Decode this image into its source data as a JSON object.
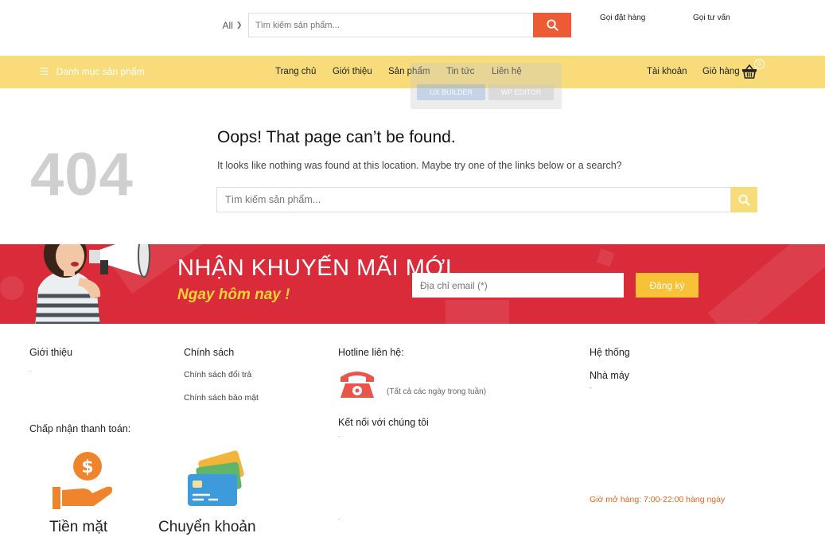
{
  "header": {
    "category_select": "All",
    "search_placeholder": "Tìm kiếm sản phẩm...",
    "call_order": "Gọi đặt hàng",
    "call_consult": "Gọi tư vấn"
  },
  "nav": {
    "menu_label": "Danh mục sản phẩm",
    "items": [
      "Trang chủ",
      "Giới thiệu",
      "Sản phẩm",
      "Tin tức",
      "Liên hệ"
    ],
    "account": "Tài khoản",
    "cart": "Giỏ hàng",
    "cart_count": "0",
    "overlay_buttons": [
      "UX BUILDER",
      "WP EDITOR"
    ]
  },
  "not_found": {
    "code": "404",
    "title": "Oops! That page can’t be found.",
    "message": "It looks like nothing was found at this location. Maybe try one of the links below or a search?",
    "search_placeholder": "Tìm kiếm sản phẩm..."
  },
  "promo": {
    "title": "NHẬN KHUYẾN MÃI MỚI",
    "subtitle": "Ngay hôm nay !",
    "email_placeholder": "Địa chỉ email (*)",
    "subscribe_label": "Đăng ký"
  },
  "footer": {
    "about_title": "Giới thiệu",
    "about_text": ".",
    "policy_title": "Chính sách",
    "policy_links": [
      "Chính sách đổi trả",
      "Chính sách bảo mật"
    ],
    "hotline_title": "Hotline liên hệ:",
    "hotline_note": "(Tất cả các ngày trong tuần)",
    "connect_title": "Kết nối với chúng tôi",
    "connect_text": ".",
    "bottom_dot": ".",
    "system_title": "Hệ thống",
    "factory": "Nhà máy",
    "factory_text": "-",
    "hours": "Giờ mở hàng: 7:00-22:00 hàng ngày",
    "payment_title": "Chấp nhận thanh toán:",
    "payment_methods": [
      "Tiền mặt",
      "Chuyển khoản"
    ]
  },
  "colors": {
    "accent": "#ec5b33",
    "nav_bg": "#f8dc7a",
    "promo_bg": "#d92b3a",
    "hours_text": "#e8641e"
  }
}
